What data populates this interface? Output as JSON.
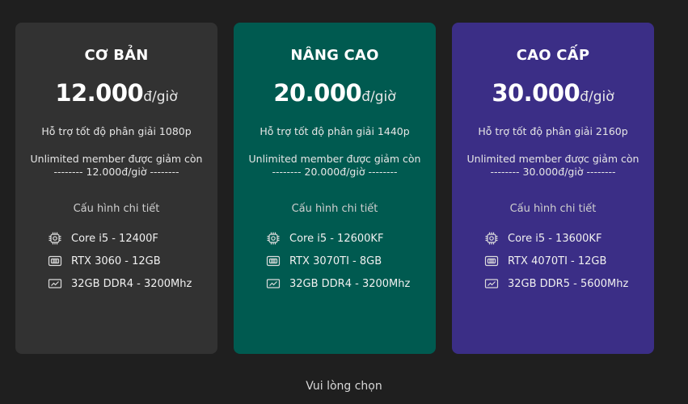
{
  "colors": {
    "background": "#1f1f1f",
    "card_basic": "#323232",
    "card_advanced": "#005a50",
    "card_premium": "#3b2e86"
  },
  "plans": [
    {
      "title": "CƠ BẢN",
      "price": "12.000",
      "unit": "đ/giờ",
      "resolution": "Hỗ trợ tốt độ phân giải 1080p",
      "member_line1": "Unlimited member được giảm còn",
      "member_line2": "-------- 12.000đ/giờ --------",
      "config_title": "Cấu hình chi tiết",
      "cpu": "Core i5 - 12400F",
      "gpu": "RTX 3060 - 12GB",
      "ram": "32GB DDR4 - 3200Mhz"
    },
    {
      "title": "NÂNG CAO",
      "price": "20.000",
      "unit": "đ/giờ",
      "resolution": "Hỗ trợ tốt độ phân giải 1440p",
      "member_line1": "Unlimited member được giảm còn",
      "member_line2": "-------- 20.000đ/giờ --------",
      "config_title": "Cấu hình chi tiết",
      "cpu": "Core i5 - 12600KF",
      "gpu": "RTX 3070TI - 8GB",
      "ram": "32GB DDR4 - 3200Mhz"
    },
    {
      "title": "CAO CẤP",
      "price": "30.000",
      "unit": "đ/giờ",
      "resolution": "Hỗ trợ tốt độ phân giải 2160p",
      "member_line1": "Unlimited member được giảm còn",
      "member_line2": "-------- 30.000đ/giờ --------",
      "config_title": "Cấu hình chi tiết",
      "cpu": "Core i5 - 13600KF",
      "gpu": "RTX 4070TI - 12GB",
      "ram": "32GB DDR5 - 5600Mhz"
    }
  ],
  "icons": {
    "cpu": "cpu-icon",
    "gpu": "gpu-icon",
    "ram": "ram-icon"
  },
  "footer": {
    "text": "Vui lòng chọn"
  }
}
